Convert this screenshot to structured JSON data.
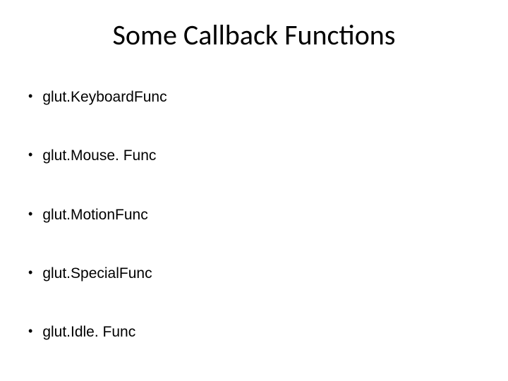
{
  "slide": {
    "title": "Some Callback Functions",
    "bullets": [
      "glut.KeyboardFunc",
      "glut.Mouse. Func",
      "glut.MotionFunc",
      "glut.SpecialFunc",
      "glut.Idle. Func"
    ]
  }
}
